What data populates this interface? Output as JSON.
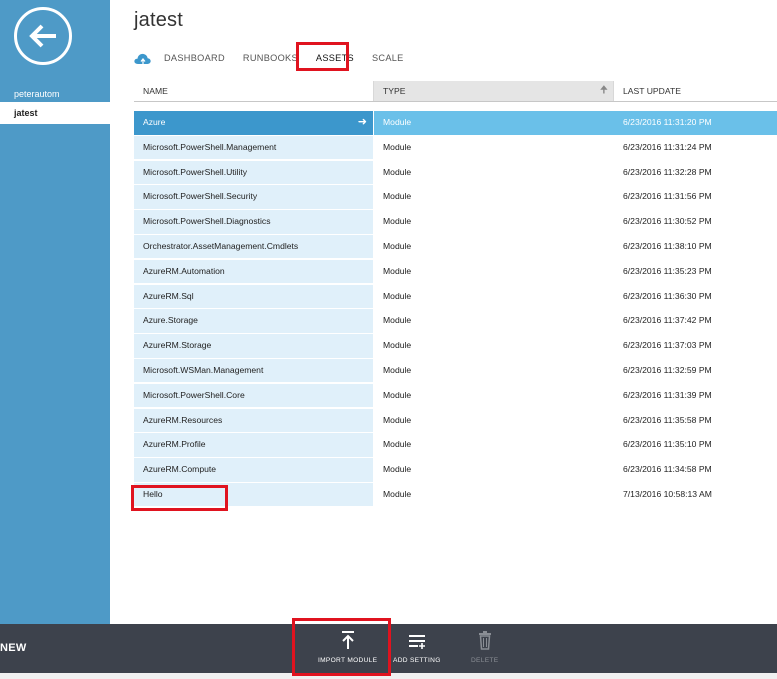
{
  "sidebar": {
    "items": [
      {
        "label": "peterautom"
      },
      {
        "label": "jatest"
      }
    ]
  },
  "page": {
    "title": "jatest"
  },
  "tabs": [
    {
      "label": "DASHBOARD"
    },
    {
      "label": "RUNBOOKS"
    },
    {
      "label": "ASSETS"
    },
    {
      "label": "SCALE"
    }
  ],
  "table": {
    "columns": [
      "NAME",
      "TYPE",
      "LAST UPDATE"
    ],
    "rows": [
      {
        "name": "Azure",
        "type": "Module",
        "date": "6/23/2016 11:31:20 PM"
      },
      {
        "name": "Microsoft.PowerShell.Management",
        "type": "Module",
        "date": "6/23/2016 11:31:24 PM"
      },
      {
        "name": "Microsoft.PowerShell.Utility",
        "type": "Module",
        "date": "6/23/2016 11:32:28 PM"
      },
      {
        "name": "Microsoft.PowerShell.Security",
        "type": "Module",
        "date": "6/23/2016 11:31:56 PM"
      },
      {
        "name": "Microsoft.PowerShell.Diagnostics",
        "type": "Module",
        "date": "6/23/2016 11:30:52 PM"
      },
      {
        "name": "Orchestrator.AssetManagement.Cmdlets",
        "type": "Module",
        "date": "6/23/2016 11:38:10 PM"
      },
      {
        "name": "AzureRM.Automation",
        "type": "Module",
        "date": "6/23/2016 11:35:23 PM"
      },
      {
        "name": "AzureRM.Sql",
        "type": "Module",
        "date": "6/23/2016 11:36:30 PM"
      },
      {
        "name": "Azure.Storage",
        "type": "Module",
        "date": "6/23/2016 11:37:42 PM"
      },
      {
        "name": "AzureRM.Storage",
        "type": "Module",
        "date": "6/23/2016 11:37:03 PM"
      },
      {
        "name": "Microsoft.WSMan.Management",
        "type": "Module",
        "date": "6/23/2016 11:32:59 PM"
      },
      {
        "name": "Microsoft.PowerShell.Core",
        "type": "Module",
        "date": "6/23/2016 11:31:39 PM"
      },
      {
        "name": "AzureRM.Resources",
        "type": "Module",
        "date": "6/23/2016 11:35:58 PM"
      },
      {
        "name": "AzureRM.Profile",
        "type": "Module",
        "date": "6/23/2016 11:35:10 PM"
      },
      {
        "name": "AzureRM.Compute",
        "type": "Module",
        "date": "6/23/2016 11:34:58 PM"
      },
      {
        "name": "Hello",
        "type": "Module",
        "date": "7/13/2016 10:58:13 AM"
      }
    ]
  },
  "commandbar": {
    "new_label": "NEW",
    "import_label": "IMPORT MODULE",
    "add_setting_label": "ADD SETTING",
    "delete_label": "DELETE"
  },
  "icons": {
    "back": "back-arrow-icon",
    "cloud": "cloud-icon",
    "sort": "sort-up-icon",
    "row_go": "arrow-right-icon",
    "import": "import-upload-icon",
    "add_setting": "add-setting-icon",
    "delete": "trash-icon"
  },
  "colors": {
    "sidebar": "#4e9ac7",
    "selected_row": "#3c97cc",
    "selected_row_light": "#6ac0e9",
    "row_name_bg": "#e0f0fa",
    "commandbar": "#3d424c",
    "annotation": "#e0131f"
  }
}
